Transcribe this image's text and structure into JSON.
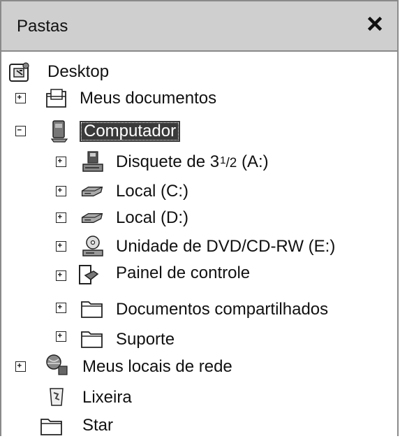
{
  "pane": {
    "title": "Pastas",
    "close_icon": "close-x-icon"
  },
  "tree": {
    "desktop": {
      "label": "Desktop",
      "icon": "desktop-icon"
    },
    "meus_documentos": {
      "label": "Meus documentos",
      "icon": "documents-folder-icon",
      "expander": "+"
    },
    "computador": {
      "label": "Computador",
      "icon": "computer-icon",
      "expander": "-",
      "selected": true
    },
    "disquete": {
      "label_prefix": "Disquete de 3",
      "label_sup": "1",
      "label_den": "/2",
      "label_suffix": " (A:)",
      "icon": "floppy-drive-icon",
      "expander": "+"
    },
    "local_c": {
      "label": "Local (C:)",
      "icon": "hard-drive-icon",
      "expander": "+"
    },
    "local_d": {
      "label": "Local (D:)",
      "icon": "hard-drive-icon",
      "expander": "+"
    },
    "dvd": {
      "label": "Unidade de DVD/CD-RW (E:)",
      "icon": "dvd-drive-icon",
      "expander": "+"
    },
    "painel": {
      "label": "Painel de controle",
      "icon": "control-panel-icon",
      "expander": "+"
    },
    "compartilhados": {
      "label": "Documentos compartilhados",
      "icon": "folder-icon",
      "expander": "+"
    },
    "suporte": {
      "label": "Suporte",
      "icon": "folder-icon",
      "expander": "+"
    },
    "rede": {
      "label": "Meus locais de rede",
      "icon": "network-places-icon",
      "expander": "+"
    },
    "lixeira": {
      "label": "Lixeira",
      "icon": "recycle-bin-icon"
    },
    "star": {
      "label": "Star",
      "icon": "folder-icon"
    }
  }
}
